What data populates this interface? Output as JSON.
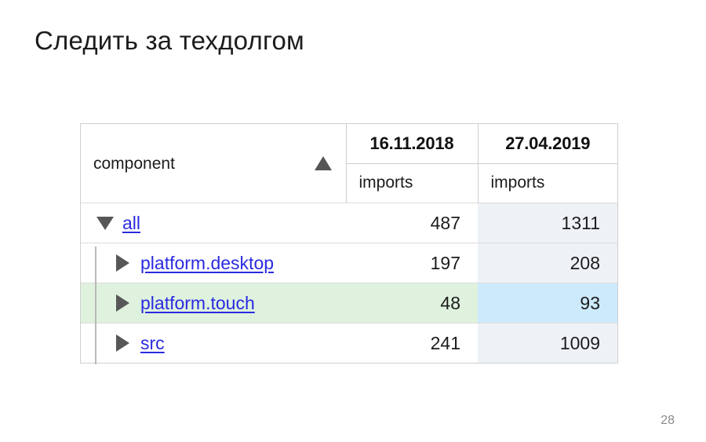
{
  "slide": {
    "title": "Следить за техдолгом",
    "page_number": "28"
  },
  "table": {
    "header": {
      "component_label": "component",
      "sort_icon": "sort-ascending-triangle-icon",
      "columns": [
        {
          "date": "16.11.2018",
          "metric": "imports"
        },
        {
          "date": "27.04.2019",
          "metric": "imports"
        }
      ]
    },
    "rows": [
      {
        "name": "all",
        "toggle_icon": "triangle-down-icon",
        "expanded": true,
        "level": 0,
        "highlighted": false,
        "values": [
          "487",
          "1311"
        ]
      },
      {
        "name": "platform.desktop",
        "toggle_icon": "triangle-right-icon",
        "expanded": false,
        "level": 1,
        "highlighted": false,
        "values": [
          "197",
          "208"
        ]
      },
      {
        "name": "platform.touch",
        "toggle_icon": "triangle-right-icon",
        "expanded": false,
        "level": 1,
        "highlighted": true,
        "values": [
          "48",
          "93"
        ]
      },
      {
        "name": "src",
        "toggle_icon": "triangle-right-icon",
        "expanded": false,
        "level": 1,
        "highlighted": false,
        "values": [
          "241",
          "1009"
        ]
      }
    ]
  },
  "colors": {
    "link": "#2a2ae0",
    "highlight_row": "#dff2de",
    "highlight_cell": "#cdeafc",
    "column_tint": "#eef2f7",
    "border": "#cfcfcf",
    "arrow": "#575757"
  }
}
